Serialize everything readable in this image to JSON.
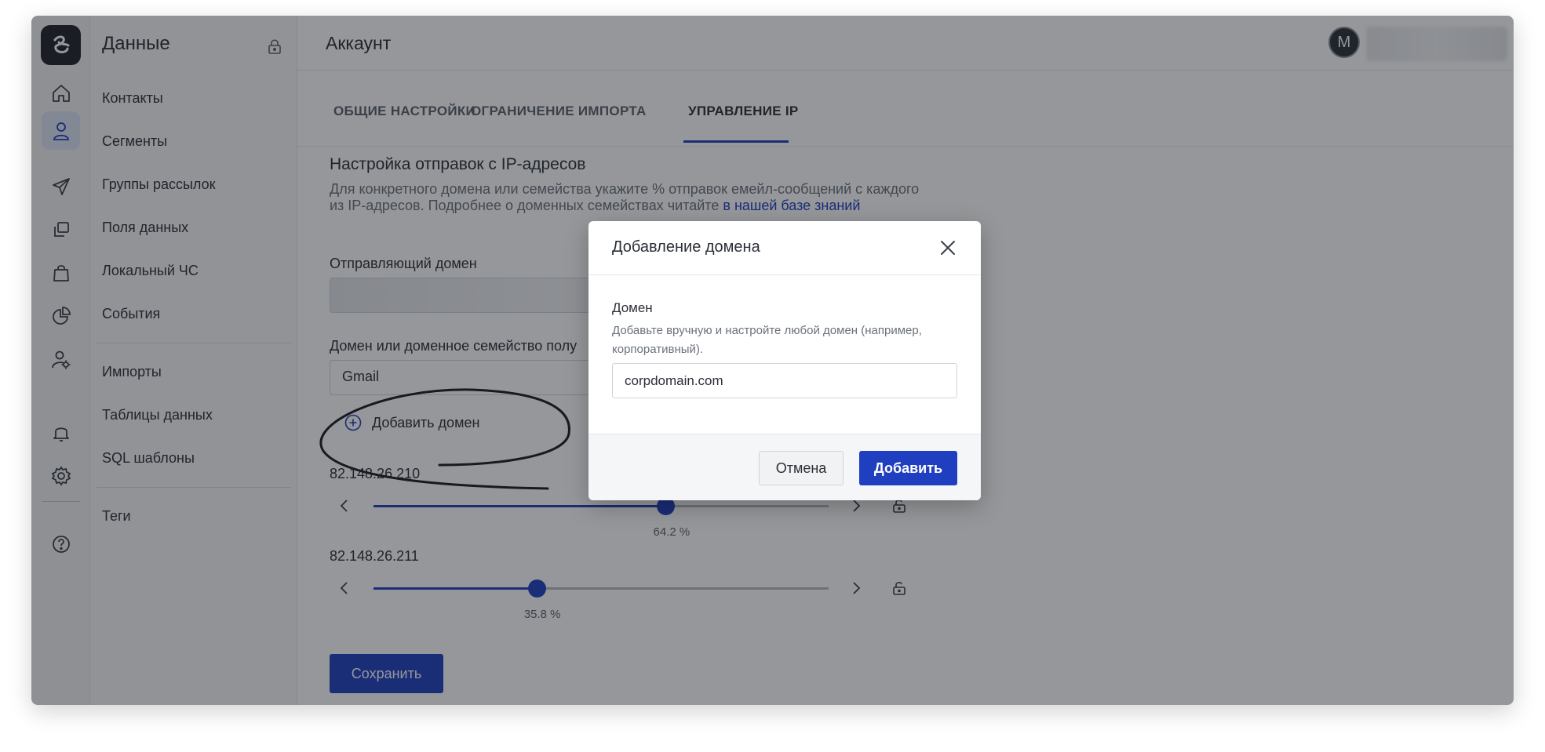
{
  "sidebar": {
    "title": "Данные",
    "items": [
      {
        "label": "Контакты"
      },
      {
        "label": "Сегменты"
      },
      {
        "label": "Группы рассылок"
      },
      {
        "label": "Поля данных"
      },
      {
        "label": "Локальный ЧС"
      },
      {
        "label": "События"
      },
      {
        "label": "Импорты"
      },
      {
        "label": "Таблицы данных"
      },
      {
        "label": "SQL шаблоны"
      },
      {
        "label": "Теги"
      }
    ]
  },
  "rail": {
    "icons": [
      "logo-icon",
      "home-icon",
      "user-icon",
      "send-icon",
      "copy-icon",
      "bag-icon",
      "pie-chart-icon",
      "user-settings-icon",
      "bell-icon",
      "gear-icon",
      "help-icon"
    ],
    "active": "user-icon"
  },
  "header": {
    "title": "Аккаунт",
    "avatar_letter": "M"
  },
  "tabs": [
    {
      "label": "ОБЩИЕ НАСТРОЙКИ",
      "active": false
    },
    {
      "label": "ОГРАНИЧЕНИЕ ИМПОРТА",
      "active": false
    },
    {
      "label": "УПРАВЛЕНИЕ IP",
      "active": true
    }
  ],
  "section": {
    "title": "Настройка отправок с IP-адресов",
    "description_lines": [
      "Для конкретного домена или семейства укажите % отправок емейл-сообщений с каждого",
      "из IP-адресов. Подробнее о доменных семействах читайте "
    ],
    "link_text": "в нашей базе знаний",
    "sending_domain_label": "Отправляющий домен",
    "recipient_domain_label": "Домен или доменное семейство полу",
    "recipient_domain_value": "Gmail",
    "add_domain_label": "Добавить домен"
  },
  "ips": [
    {
      "address": "82.148.26.210",
      "percent_label": "64.2 %",
      "percent": 64.2
    },
    {
      "address": "82.148.26.211",
      "percent_label": "35.8 %",
      "percent": 35.8
    }
  ],
  "save_label": "Сохранить",
  "modal": {
    "title": "Добавление домена",
    "field_label": "Домен",
    "hint": "Добавьте вручную и настройте любой домен (например, корпоративный).",
    "input_value": "corpdomain.com",
    "cancel_label": "Отмена",
    "add_label": "Добавить"
  },
  "colors": {
    "accent": "#1f3fc0",
    "overlay": "rgba(20,24,32,0.45)"
  }
}
